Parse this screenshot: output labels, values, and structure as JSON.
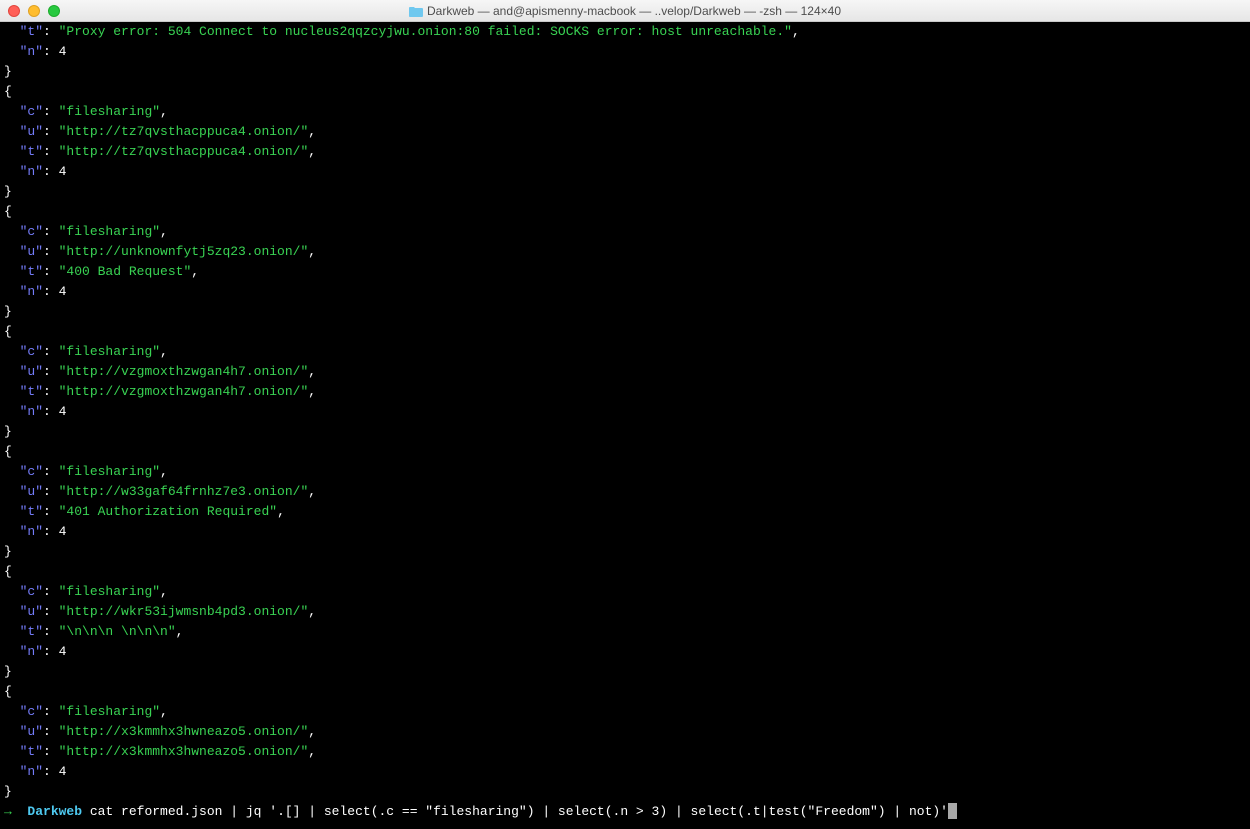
{
  "window": {
    "title": "Darkweb — and@apismenny-macbook — ..velop/Darkweb — -zsh — 124×40"
  },
  "partial_first": {
    "t": "Proxy error: 504 Connect to nucleus2qqzcyjwu.onion:80 failed: SOCKS error: host unreachable.",
    "n": "4"
  },
  "records": [
    {
      "c": "filesharing",
      "u": "http://tz7qvsthacppuca4.onion/",
      "t": "http://tz7qvsthacppuca4.onion/",
      "n": "4"
    },
    {
      "c": "filesharing",
      "u": "http://unknownfytj5zq23.onion/",
      "t": "400 Bad Request",
      "n": "4"
    },
    {
      "c": "filesharing",
      "u": "http://vzgmoxthzwgan4h7.onion/",
      "t": "http://vzgmoxthzwgan4h7.onion/",
      "n": "4"
    },
    {
      "c": "filesharing",
      "u": "http://w33gaf64frnhz7e3.onion/",
      "t": "401 Authorization Required",
      "n": "4"
    },
    {
      "c": "filesharing",
      "u": "http://wkr53ijwmsnb4pd3.onion/",
      "t": "\\n\\n\\n \\n\\n\\n",
      "n": "4"
    },
    {
      "c": "filesharing",
      "u": "http://x3kmmhx3hwneazo5.onion/",
      "t": "http://x3kmmhx3hwneazo5.onion/",
      "n": "4"
    }
  ],
  "prompt": {
    "arrow": "→",
    "dir": "Darkweb",
    "command": "cat reformed.json | jq '.[] | select(.c == \"filesharing\") | select(.n > 3) | select(.t|test(\"Freedom\") | not)'"
  }
}
